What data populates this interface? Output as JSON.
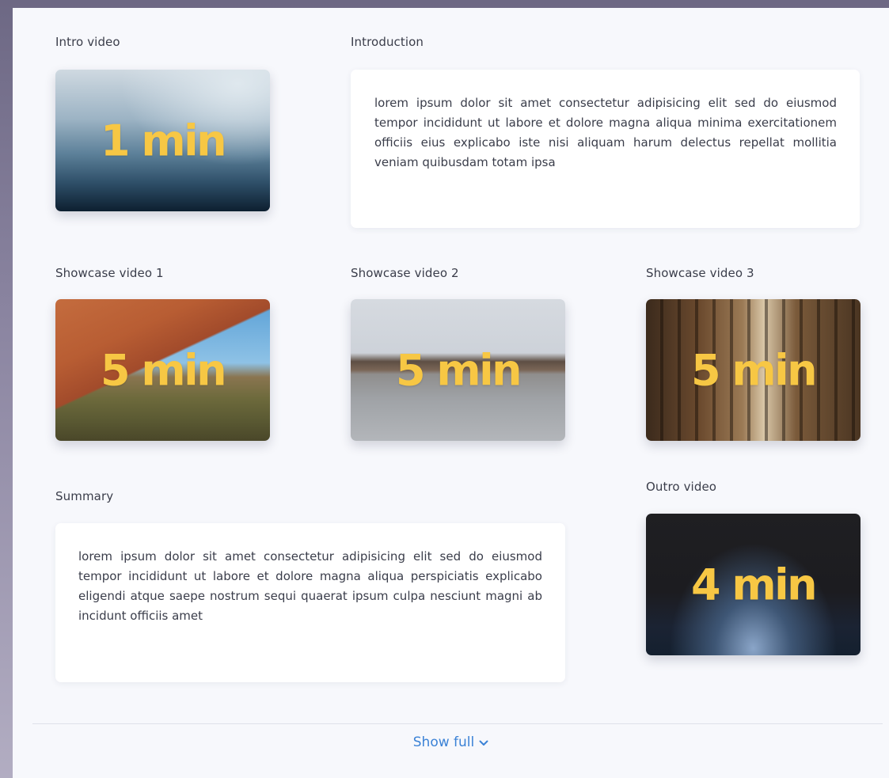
{
  "intro": {
    "label": "Intro video",
    "duration": "1 min"
  },
  "introduction": {
    "label": "Introduction",
    "text": "lorem ipsum dolor sit amet consectetur adipisicing elit sed do eiusmod tempor incididunt ut labore et dolore magna aliqua minima exercitationem officiis eius explicabo iste nisi aliquam harum delectus repellat mollitia veniam quibusdam totam ipsa"
  },
  "showcase": [
    {
      "label": "Showcase video 1",
      "duration": "5 min"
    },
    {
      "label": "Showcase video 2",
      "duration": "5 min"
    },
    {
      "label": "Showcase video 3",
      "duration": "5 min"
    }
  ],
  "summary": {
    "label": "Summary",
    "text": "lorem ipsum dolor sit amet consectetur adipisicing elit sed do eiusmod tempor incididunt ut labore et dolore magna aliqua perspiciatis explicabo eligendi atque saepe nostrum sequi quaerat ipsum culpa nesciunt magni ab incidunt officiis amet"
  },
  "outro": {
    "label": "Outro video",
    "duration": "4 min"
  },
  "footer": {
    "show_full_label": "Show full",
    "chevron_icon": "chevron-down-icon"
  },
  "colors": {
    "duration_text": "#f7c744",
    "link": "#3b82d6",
    "panel_background": "#f7f8fc"
  }
}
